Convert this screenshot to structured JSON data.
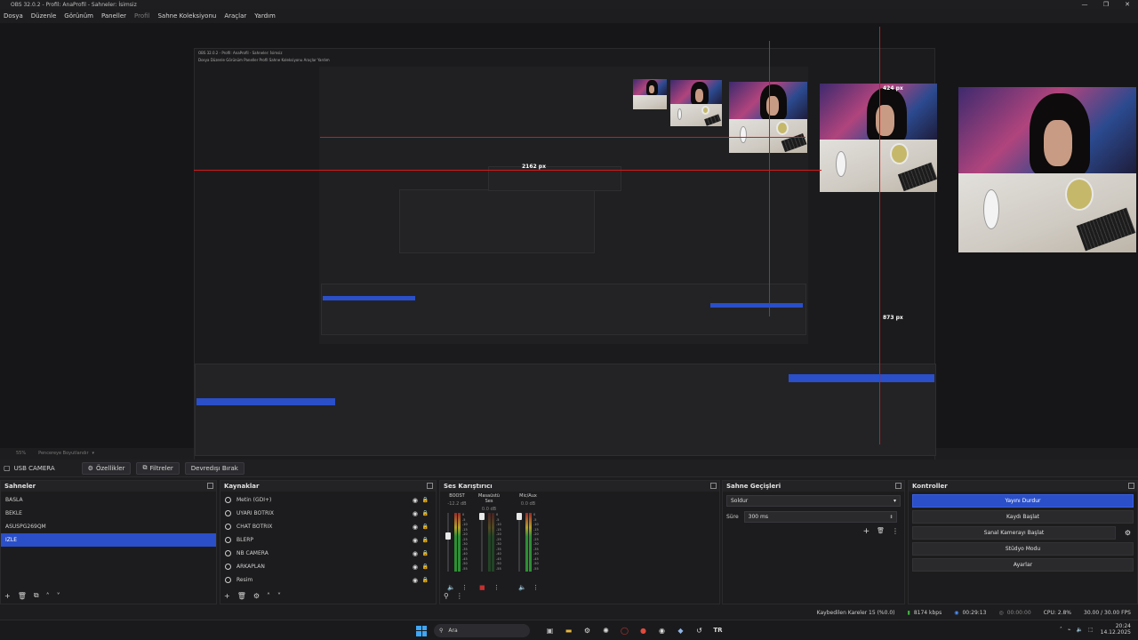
{
  "window": {
    "title": "OBS 32.0.2 - Profil: AnaProfil - Sahneler: İsimsiz",
    "controls": [
      "—",
      "❐",
      "✕"
    ]
  },
  "menu": [
    "Dosya",
    "Düzenle",
    "Görünüm",
    "Paneller",
    "Profil",
    "Sahne Koleksiyonu",
    "Araçlar",
    "Yardım"
  ],
  "preview": {
    "guides": {
      "top": "424 px",
      "left": "2162 px",
      "bottom": "873 px"
    },
    "nested_title": "OBS 32.0.2 - Profil: AnaProfil - Sahneler: İsimsiz",
    "nested_menu": "Dosya   Düzenle   Görünüm   Paneller   Profil   Sahne Koleksiyonu   Araçlar   Yardım"
  },
  "scale_row": {
    "zoom": "55%",
    "label": "Pencereye Boyutlandır"
  },
  "toolbar": {
    "source_name": "USB CAMERA",
    "properties": "Özellikler",
    "filters": "Filtreler",
    "deactivate": "Devredışı Bırak"
  },
  "scenes": {
    "title": "Sahneler",
    "items": [
      "BASLA",
      "BEKLE",
      "ASUSPG269QM",
      "IZLE"
    ],
    "selected": 3
  },
  "sources": {
    "title": "Kaynaklar",
    "items": [
      "Metin (GDI+)",
      "UYARI BOTRIX",
      "CHAT BOTRIX",
      "BLERP",
      "NB CAMERA",
      "ARKAPLAN",
      "Resim"
    ]
  },
  "mixer": {
    "title": "Ses Karıştırıcı",
    "channels": [
      {
        "name": "BOOST",
        "db": "-12.2 dB",
        "level": 0.55
      },
      {
        "name": "Masaüstü Ses",
        "db": "0.0 dB",
        "level": 0.0
      },
      {
        "name": "Mic/Aux",
        "db": "0.0 dB",
        "level": 0.45
      }
    ],
    "scale": [
      "0",
      "-5",
      "-10",
      "-15",
      "-20",
      "-25",
      "-30",
      "-35",
      "-40",
      "-45",
      "-50",
      "-55",
      "-60"
    ]
  },
  "transitions": {
    "title": "Sahne Geçişleri",
    "selected": "Soldur",
    "duration_label": "Süre",
    "duration_value": "300 ms"
  },
  "controls": {
    "title": "Kontroller",
    "stop_stream": "Yayını Durdur",
    "start_record": "Kaydı Başlat",
    "virtual_cam": "Sanal Kamerayı Başlat",
    "studio_mode": "Stüdyo Modu",
    "settings": "Ayarlar"
  },
  "status": {
    "dropped": "Kaybedilen Kareler 15 (%0.0)",
    "bitrate": "8174 kbps",
    "stream_time": "00:29:13",
    "rec_time": "00:00:00",
    "cpu": "CPU: 2.8%",
    "fps": "30.00 / 30.00 FPS"
  },
  "taskbar": {
    "search": "Ara",
    "lang": "TR",
    "time": "20:24",
    "date": "14.12.2025"
  },
  "colors": {
    "accent": "#2a4fc9",
    "guide": "#d11a1a",
    "panel": "#1c1c1e"
  }
}
